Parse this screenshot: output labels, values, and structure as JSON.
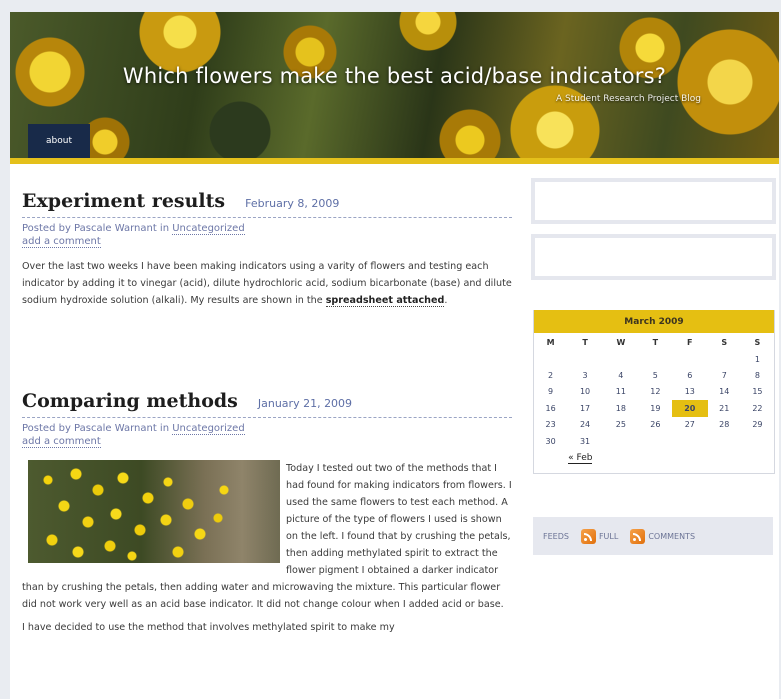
{
  "site": {
    "title": "Which flowers make the best acid/base indicators?",
    "tagline": "A Student Research Project Blog",
    "nav": [
      "about"
    ]
  },
  "posts": [
    {
      "title": "Experiment results",
      "date": "February 8, 2009",
      "posted_by_prefix": "Posted by Pascale Warnant in ",
      "category": "Uncategorized",
      "comment_link": "add a comment",
      "body_before_link": "Over the last two weeks I have been making indicators using a varity of flowers and testing each indicator by adding it to vinegar (acid), dilute hydrochloric acid, sodium bicarbonate (base) and dilute sodium hydroxide solution (alkali). My results are shown in the ",
      "body_link": "spreadsheet attached",
      "body_after_link": "."
    },
    {
      "title": "Comparing methods",
      "date": "January 21, 2009",
      "posted_by_prefix": "Posted by Pascale Warnant in ",
      "category": "Uncategorized",
      "comment_link": "add a comment",
      "body": "Today I tested out two of the methods that I had found for making indicators from flowers. I used the same flowers to test each method. A picture of the type of flowers I used is shown on the left. I found that by crushing the petals, then adding methylated spirit to extract the flower pigment I obtained a darker indicator than by crushing the petals, then adding water and microwaving the mixture. This particular flower did not work very well as an acid base indicator. It did not change colour when I added acid or base.",
      "body2": "I have decided to use the method that involves methylated spirit to make my"
    }
  ],
  "sidebar": {
    "calendar": {
      "caption": "March 2009",
      "weekdays": [
        "M",
        "T",
        "W",
        "T",
        "F",
        "S",
        "S"
      ],
      "weeks": [
        [
          "",
          "",
          "",
          "",
          "",
          "",
          "1"
        ],
        [
          "2",
          "3",
          "4",
          "5",
          "6",
          "7",
          "8"
        ],
        [
          "9",
          "10",
          "11",
          "12",
          "13",
          "14",
          "15"
        ],
        [
          "16",
          "17",
          "18",
          "19",
          "20",
          "21",
          "22"
        ],
        [
          "23",
          "24",
          "25",
          "26",
          "27",
          "28",
          "29"
        ],
        [
          "30",
          "31",
          "",
          "",
          "",
          "",
          ""
        ]
      ],
      "today": "20",
      "prev_link": "« Feb"
    },
    "feeds": {
      "label": "FEEDS",
      "full": "FULL",
      "comments": "COMMENTS"
    }
  }
}
